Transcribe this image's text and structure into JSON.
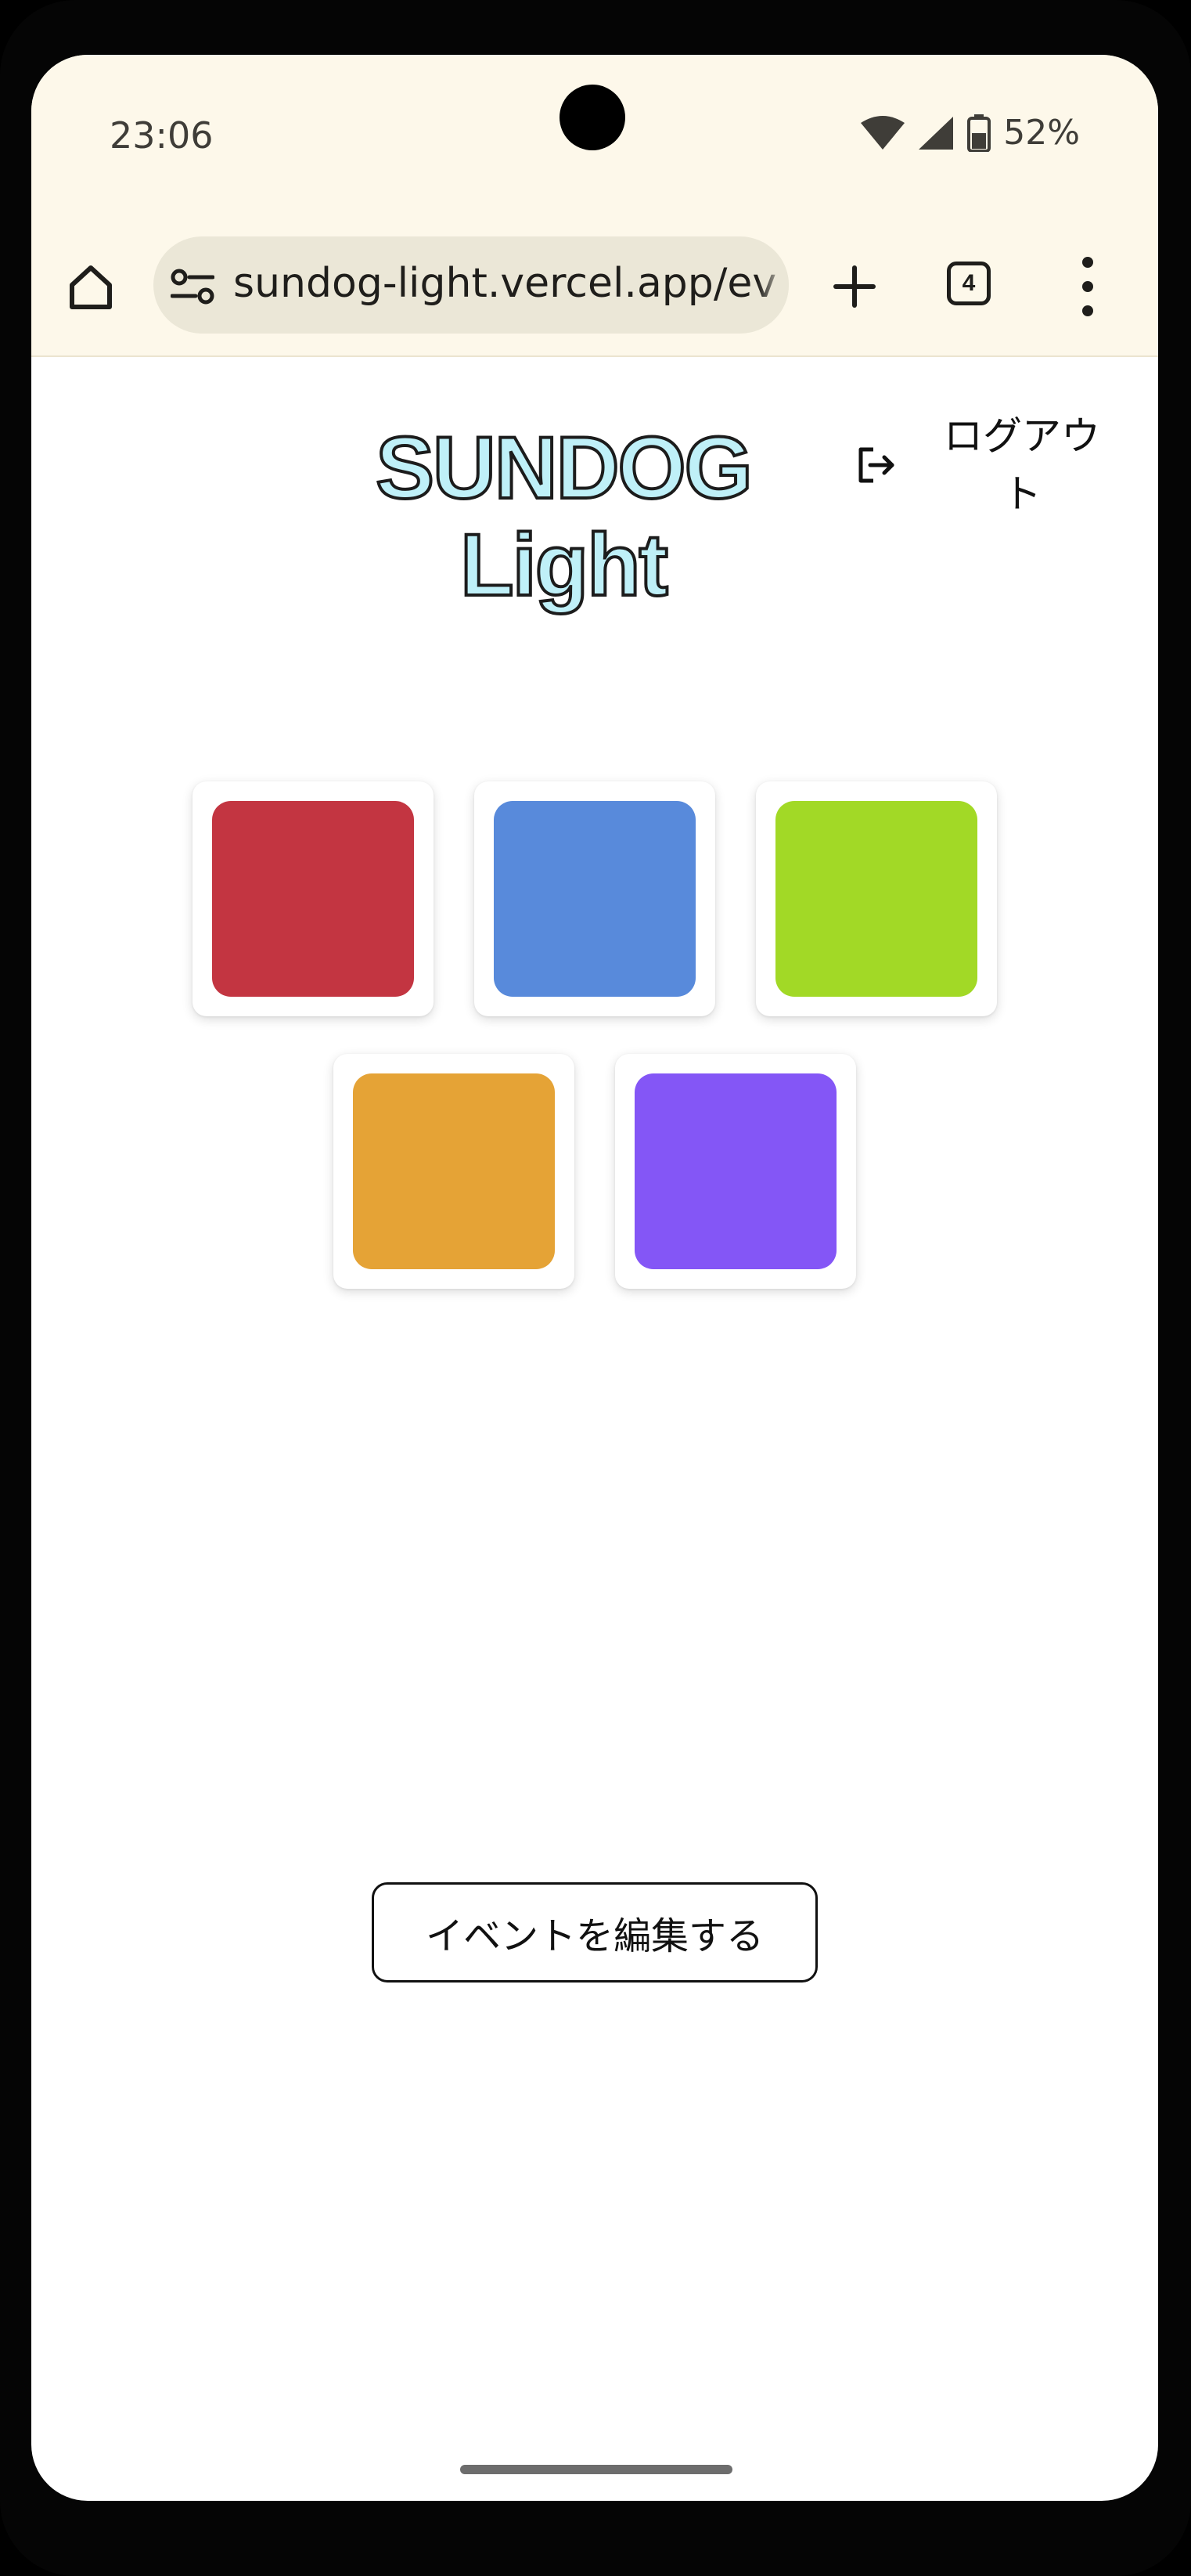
{
  "status_bar": {
    "time": "23:06",
    "battery": "52%"
  },
  "browser": {
    "url": "sundog-light.vercel.app/ev",
    "tab_count": "4"
  },
  "header": {
    "logo_line1": "SUNDOG",
    "logo_line2": "Light",
    "logout_label": "ログアウト"
  },
  "tiles": [
    {
      "color": "#c33541"
    },
    {
      "color": "#588adb"
    },
    {
      "color": "#a2d926"
    },
    {
      "color": "#e5a336"
    },
    {
      "color": "#8456f6"
    }
  ],
  "actions": {
    "edit_event_label": "イベントを編集する"
  }
}
